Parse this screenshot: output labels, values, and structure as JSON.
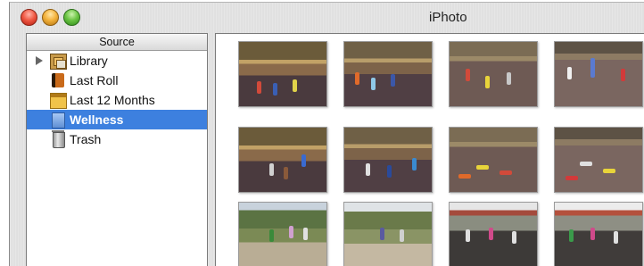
{
  "window": {
    "title": "iPhoto"
  },
  "sidebar": {
    "header": "Source",
    "items": [
      {
        "label": "Library",
        "icon": "library-icon",
        "expandable": true,
        "selected": false
      },
      {
        "label": "Last Roll",
        "icon": "film-roll-icon",
        "expandable": false,
        "selected": false
      },
      {
        "label": "Last 12 Months",
        "icon": "calendar-icon",
        "expandable": false,
        "selected": false
      },
      {
        "label": "Wellness",
        "icon": "album-icon",
        "expandable": false,
        "selected": true
      },
      {
        "label": "Trash",
        "icon": "trash-icon",
        "expandable": false,
        "selected": false
      }
    ]
  },
  "colors": {
    "selection": "#3d80df",
    "close": "#f05a45",
    "minimize": "#f4b33d",
    "zoom": "#6cc545"
  }
}
